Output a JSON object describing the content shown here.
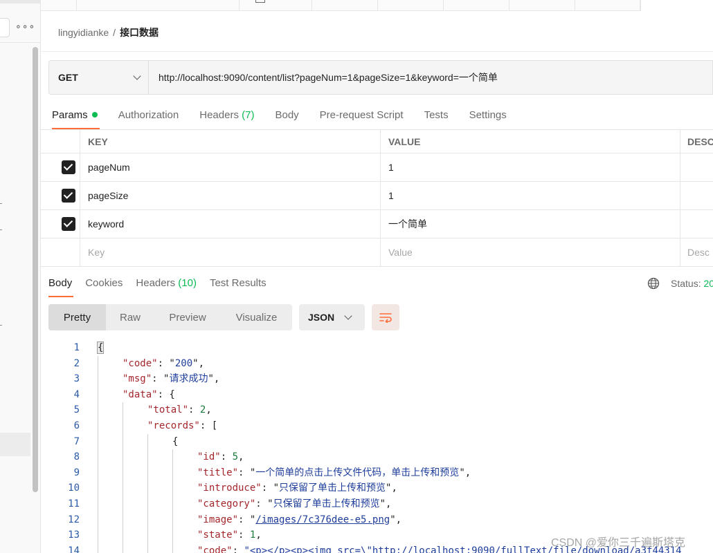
{
  "breadcrumb": {
    "workspace": "lingyidianke",
    "separator": "/",
    "request_name": "接口数据"
  },
  "request": {
    "method": "GET",
    "url": "http://localhost:9090/content/list?pageNum=1&pageSize=1&keyword=一个简单"
  },
  "request_tabs": [
    {
      "label": "Params",
      "count": ""
    },
    {
      "label": "Authorization",
      "count": ""
    },
    {
      "label": "Headers",
      "count": "(7)"
    },
    {
      "label": "Body",
      "count": ""
    },
    {
      "label": "Pre-request Script",
      "count": ""
    },
    {
      "label": "Tests",
      "count": ""
    },
    {
      "label": "Settings",
      "count": ""
    }
  ],
  "params_table": {
    "headers": {
      "key": "KEY",
      "value": "VALUE",
      "description": "DESC"
    },
    "rows": [
      {
        "checked": true,
        "key": "pageNum",
        "value": "1"
      },
      {
        "checked": true,
        "key": "pageSize",
        "value": "1"
      },
      {
        "checked": true,
        "key": "keyword",
        "value": "一个简单"
      }
    ],
    "placeholders": {
      "key": "Key",
      "value": "Value",
      "description": "Desc"
    }
  },
  "response_tabs": [
    {
      "label": "Body",
      "count": ""
    },
    {
      "label": "Cookies",
      "count": ""
    },
    {
      "label": "Headers",
      "count": "(10)"
    },
    {
      "label": "Test Results",
      "count": ""
    }
  ],
  "status": {
    "label": "Status:",
    "value": "20"
  },
  "view_modes": [
    "Pretty",
    "Raw",
    "Preview",
    "Visualize"
  ],
  "format": "JSON",
  "code_lines": [
    {
      "n": "1",
      "text": "{"
    },
    {
      "n": "2",
      "text": "\"code\": \"200\","
    },
    {
      "n": "3",
      "text": "\"msg\": \"请求成功\","
    },
    {
      "n": "4",
      "text": "\"data\": {"
    },
    {
      "n": "5",
      "text": "\"total\": 2,"
    },
    {
      "n": "6",
      "text": "\"records\": ["
    },
    {
      "n": "7",
      "text": "{"
    },
    {
      "n": "8",
      "text": "\"id\": 5,"
    },
    {
      "n": "9",
      "text": "\"title\": \"一个简单的点击上传文件代码，单击上传和预览\","
    },
    {
      "n": "10",
      "text": "\"introduce\": \"只保留了单击上传和预览\","
    },
    {
      "n": "11",
      "text": "\"category\": \"只保留了单击上传和预览\","
    },
    {
      "n": "12",
      "text": "\"image\": \"/images/7c376dee-e5.png\","
    },
    {
      "n": "13",
      "text": "\"state\": 1,"
    },
    {
      "n": "14",
      "text": "\"code\": \"<p></p><p><img src=\\\"http://localhost:9090/fullText/file/download/a3f44314"
    }
  ],
  "watermark": "CSDN @爱你三千遍斯塔克",
  "colors": {
    "accent": "#ff6c37",
    "success": "#0cbb52",
    "json_key": "#a3262c",
    "json_string": "#1e3d9b",
    "json_number": "#1a7a3a"
  }
}
